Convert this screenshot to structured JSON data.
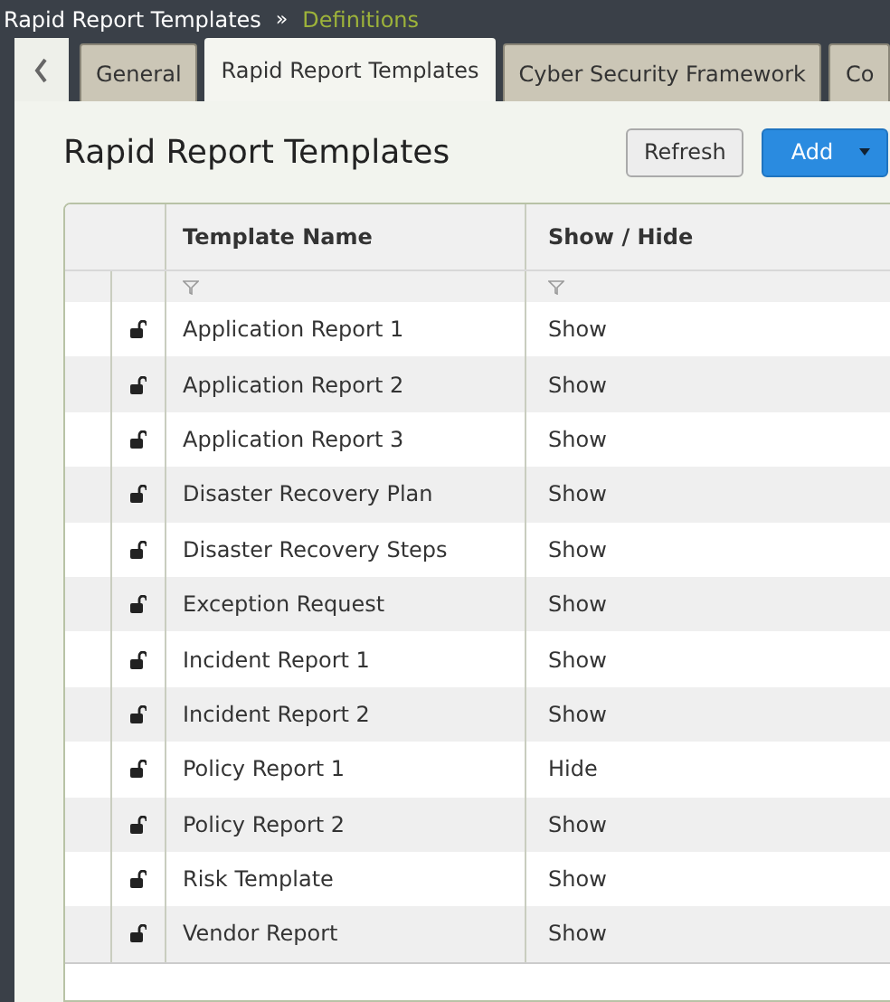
{
  "breadcrumb": {
    "parent": "Rapid Report Templates",
    "separator": "»",
    "current": "Definitions"
  },
  "tabs": [
    {
      "label": "General",
      "selected": false
    },
    {
      "label": "Rapid Report Templates",
      "selected": true
    },
    {
      "label": "Cyber Security Framework",
      "selected": false
    },
    {
      "label": "Co",
      "selected": false
    }
  ],
  "page_title": "Rapid Report Templates",
  "buttons": [
    {
      "label": "Refresh",
      "kind": "secondary"
    },
    {
      "label": "Add",
      "kind": "primary"
    }
  ],
  "table": {
    "columns": [
      "Template Name",
      "Show / Hide"
    ],
    "rows": [
      {
        "name": "Application Report 1",
        "visibility": "Show"
      },
      {
        "name": "Application Report 2",
        "visibility": "Show"
      },
      {
        "name": "Application Report 3",
        "visibility": "Show"
      },
      {
        "name": "Disaster Recovery Plan",
        "visibility": "Show"
      },
      {
        "name": "Disaster Recovery Steps",
        "visibility": "Show"
      },
      {
        "name": "Exception Request",
        "visibility": "Show"
      },
      {
        "name": "Incident Report 1",
        "visibility": "Show"
      },
      {
        "name": "Incident Report 2",
        "visibility": "Show"
      },
      {
        "name": "Policy Report 1",
        "visibility": "Hide"
      },
      {
        "name": "Policy Report 2",
        "visibility": "Show"
      },
      {
        "name": "Risk Template",
        "visibility": "Show"
      },
      {
        "name": "Vendor Report",
        "visibility": "Show"
      }
    ]
  }
}
